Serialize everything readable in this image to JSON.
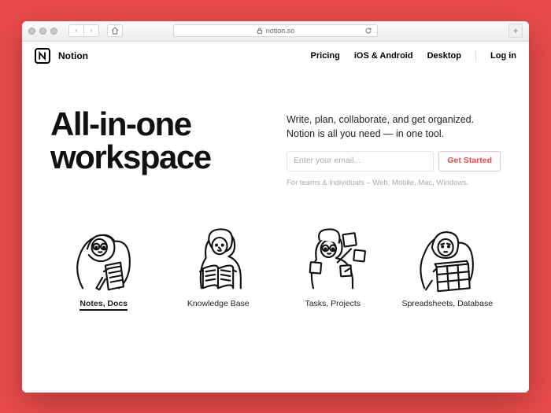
{
  "browser": {
    "url_host": "notion.so"
  },
  "brand": "Notion",
  "nav": {
    "pricing": "Pricing",
    "mobile": "iOS & Android",
    "desktop": "Desktop",
    "login": "Log in"
  },
  "hero": {
    "title_line1": "All-in-one",
    "title_line2": "workspace",
    "tagline_line1": "Write, plan, collaborate, and get organized.",
    "tagline_line2": "Notion is all you need — in one tool.",
    "email_placeholder": "Enter your email...",
    "cta": "Get Started",
    "sub": "For teams & individuals – Web, Mobile, Mac, Windows."
  },
  "features": [
    {
      "label": "Notes, Docs"
    },
    {
      "label": "Knowledge Base"
    },
    {
      "label": "Tasks, Projects"
    },
    {
      "label": "Spreadsheets, Database"
    }
  ]
}
